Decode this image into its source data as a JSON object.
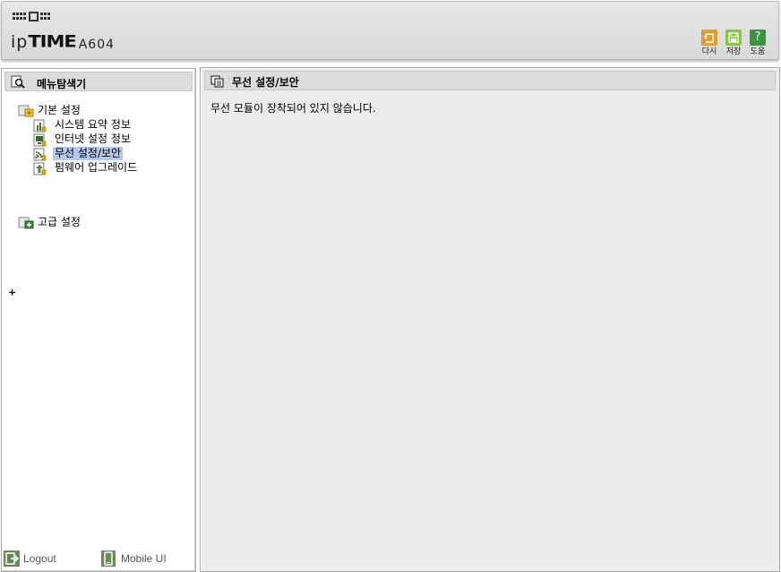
{
  "header": {
    "logo": {
      "ip": "ip",
      "time": "TIME",
      "model": "A604"
    },
    "buttons": [
      {
        "label": "다시",
        "icon": "refresh-icon",
        "color": "#e0a030"
      },
      {
        "label": "저장",
        "icon": "save-icon",
        "color": "#8cc63f"
      },
      {
        "label": "도움",
        "icon": "help-icon",
        "glyph": "?",
        "color": "#3d9140"
      }
    ]
  },
  "sidebar": {
    "title": "메뉴탐색기",
    "groups": [
      {
        "label": "기본 설정",
        "items": [
          {
            "label": "시스템 요약 정보"
          },
          {
            "label": "인터넷 설정 정보"
          },
          {
            "label": "무선 설정/보안",
            "selected": true
          },
          {
            "label": "펌웨어 업그레이드"
          }
        ]
      },
      {
        "label": "고급 설정",
        "toggle": "+"
      }
    ],
    "footer": {
      "logout": "Logout",
      "mobile": "Mobile UI"
    }
  },
  "content": {
    "title": "무선 설정/보안",
    "message": "무선 모듈이 장착되어 있지 않습니다."
  },
  "colors": {
    "selection": "#b4c8e8",
    "panel_header": "#dcdcdc",
    "content_bg": "#ececec"
  }
}
